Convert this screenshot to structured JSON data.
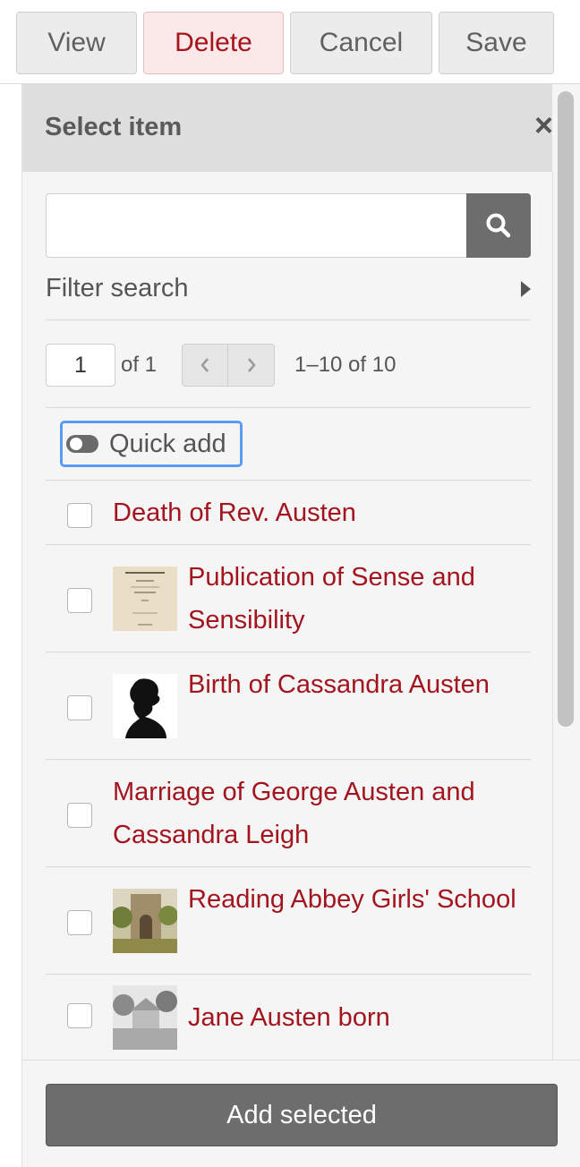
{
  "toolbar": {
    "view_label": "View",
    "delete_label": "Delete",
    "cancel_label": "Cancel",
    "save_label": "Save"
  },
  "sidebar": {
    "title": "Select item",
    "close_icon": "×",
    "search": {
      "value": "",
      "placeholder": ""
    },
    "filter_label": "Filter search",
    "pagination": {
      "current_page": "1",
      "of_label": "of 1",
      "range": "1–10 of 10"
    },
    "quick_add_label": "Quick add",
    "items": [
      {
        "title": "Death of Rev. Austen",
        "has_thumbnail": false
      },
      {
        "title": "Publication of Sense and Sensibility",
        "has_thumbnail": true,
        "thumbnail": "book-title-page"
      },
      {
        "title": "Birth of Cassandra Austen",
        "has_thumbnail": true,
        "thumbnail": "silhouette-portrait"
      },
      {
        "title": "Marriage of George Austen and Cassandra Leigh",
        "has_thumbnail": false
      },
      {
        "title": "Reading Abbey Girls' School",
        "has_thumbnail": true,
        "thumbnail": "abbey-gateway-painting"
      },
      {
        "title": "Jane Austen born",
        "has_thumbnail": true,
        "thumbnail": "rectory-engraving"
      }
    ],
    "add_selected_label": "Add selected"
  },
  "colors": {
    "accent_red": "#a3151e",
    "delete_bg": "#fbe9e9",
    "header_bg": "#dedede",
    "dark_button": "#6d6d6d",
    "focus_ring": "#5b9cf3"
  }
}
